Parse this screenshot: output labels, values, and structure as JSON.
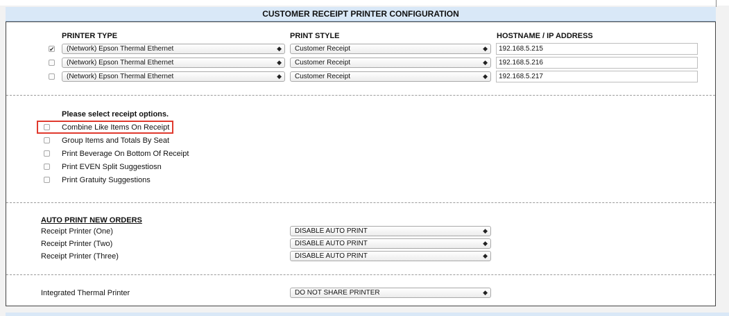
{
  "header": {
    "title": "CUSTOMER RECEIPT PRINTER CONFIGURATION"
  },
  "printers": {
    "columns": {
      "type": "PRINTER TYPE",
      "style": "PRINT STYLE",
      "host": "HOSTNAME / IP ADDRESS"
    },
    "rows": [
      {
        "checked": true,
        "type": "(Network) Epson Thermal Ethernet",
        "style": "Customer Receipt",
        "host": "192.168.5.215"
      },
      {
        "checked": false,
        "type": "(Network) Epson Thermal Ethernet",
        "style": "Customer Receipt",
        "host": "192.168.5.216"
      },
      {
        "checked": false,
        "type": "(Network) Epson Thermal Ethernet",
        "style": "Customer Receipt",
        "host": "192.168.5.217"
      }
    ]
  },
  "options": {
    "heading": "Please select receipt options.",
    "items": [
      {
        "label": "Combine Like Items On Receipt",
        "checked": false
      },
      {
        "label": "Group Items and Totals By Seat",
        "checked": false
      },
      {
        "label": "Print Beverage On Bottom Of Receipt",
        "checked": false
      },
      {
        "label": "Print EVEN Split Suggestiosn",
        "checked": false
      },
      {
        "label": "Print Gratuity Suggestions",
        "checked": false
      }
    ]
  },
  "auto_print": {
    "heading": "AUTO PRINT NEW ORDERS",
    "rows": [
      {
        "label": "Receipt Printer (One)",
        "value": "DISABLE AUTO PRINT"
      },
      {
        "label": "Receipt Printer (Two)",
        "value": "DISABLE AUTO PRINT"
      },
      {
        "label": "Receipt Printer (Three)",
        "value": "DISABLE AUTO PRINT"
      }
    ]
  },
  "integrated": {
    "label": "Integrated Thermal Printer",
    "value": "DO NOT SHARE PRINTER"
  },
  "icons": {
    "checkmark": "checkmark-icon",
    "select_arrows": "up-down-arrows-icon"
  },
  "colors": {
    "header_bg": "#d9e8f7",
    "highlight": "#e03a2e"
  }
}
